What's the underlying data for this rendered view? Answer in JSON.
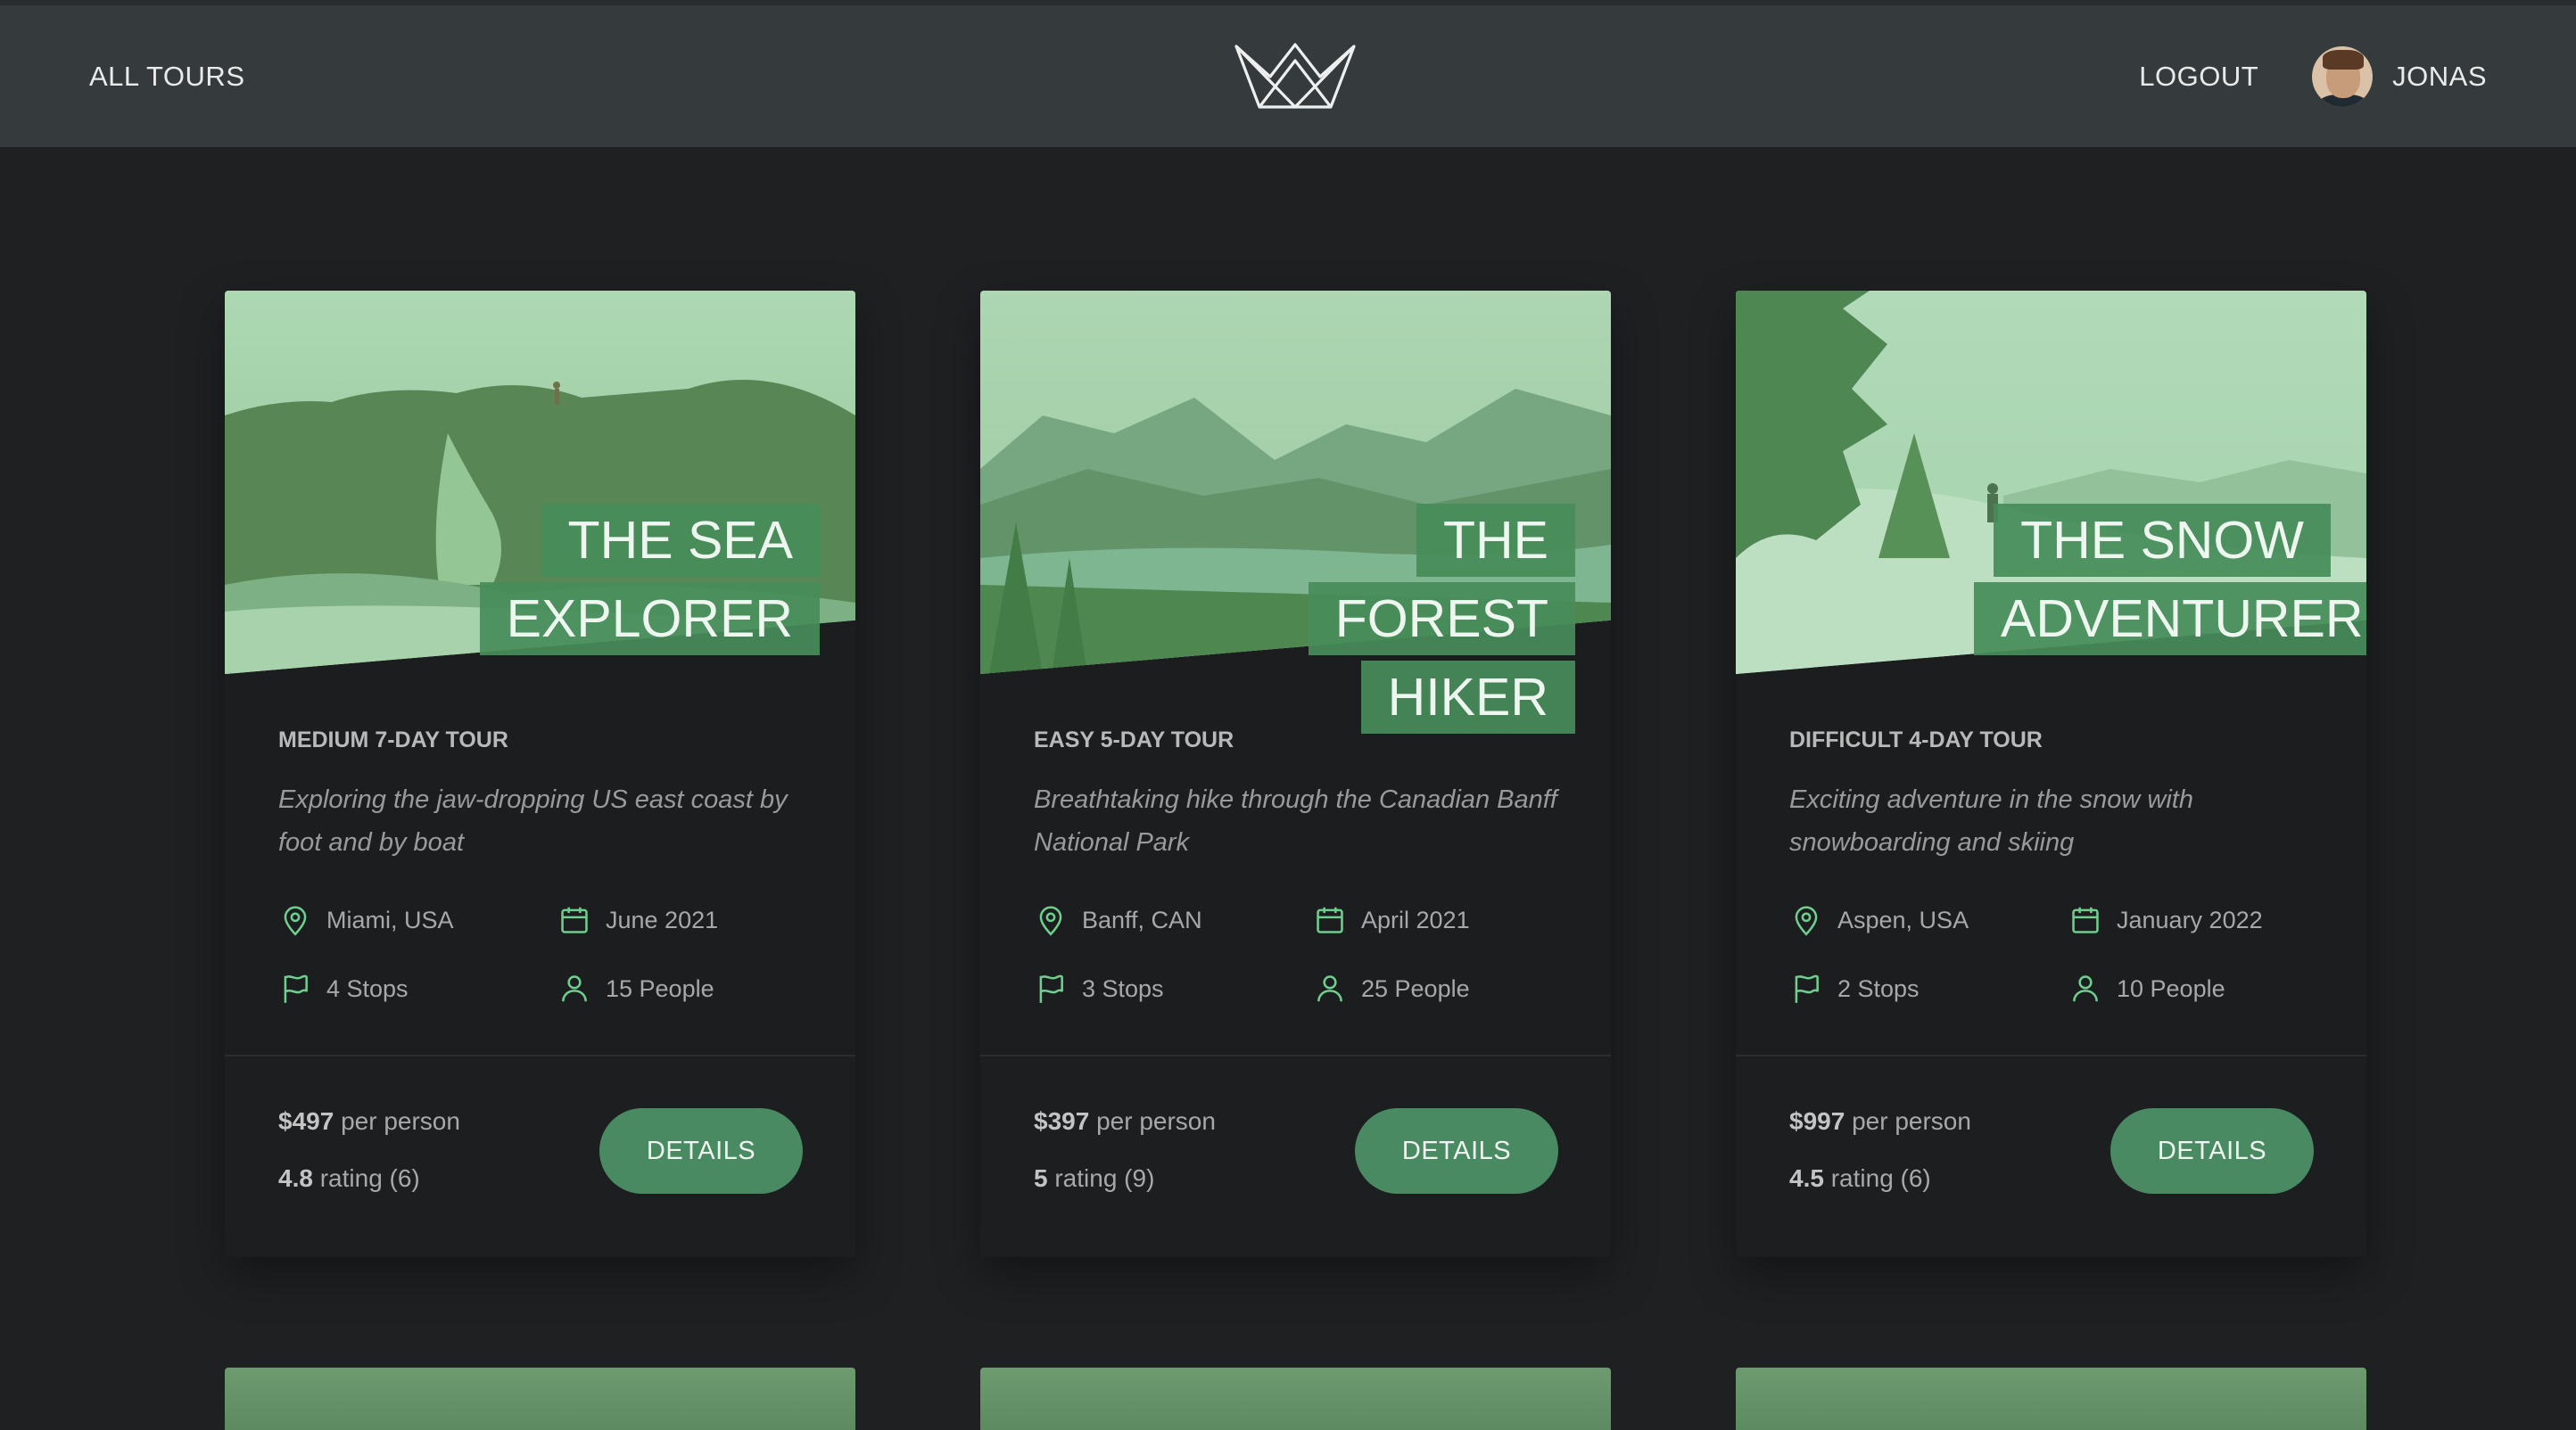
{
  "header": {
    "all_tours": "ALL TOURS",
    "logout": "LOGOUT",
    "user_name": "JONAS"
  },
  "tours": [
    {
      "name_line1": "THE SEA",
      "name_line2": "EXPLORER",
      "difficulty_duration": "MEDIUM 7-DAY TOUR",
      "summary": "Exploring the jaw-dropping US east coast by foot and by boat",
      "location": "Miami, USA",
      "date": "June 2021",
      "stops": "4 Stops",
      "people": "15 People",
      "price": "$497",
      "price_suffix": "per person",
      "rating": "4.8",
      "rating_suffix": "rating (6)",
      "button": "DETAILS"
    },
    {
      "name_line1": "THE FOREST",
      "name_line2": "HIKER",
      "difficulty_duration": "EASY 5-DAY TOUR",
      "summary": "Breathtaking hike through the Canadian Banff National Park",
      "location": "Banff, CAN",
      "date": "April 2021",
      "stops": "3 Stops",
      "people": "25 People",
      "price": "$397",
      "price_suffix": "per person",
      "rating": "5",
      "rating_suffix": "rating (9)",
      "button": "DETAILS"
    },
    {
      "name_line1": "THE SNOW",
      "name_line2": "ADVENTURER",
      "difficulty_duration": "DIFFICULT 4-DAY TOUR",
      "summary": "Exciting adventure in the snow with snowboarding and skiing",
      "location": "Aspen, USA",
      "date": "January 2022",
      "stops": "2 Stops",
      "people": "10 People",
      "price": "$997",
      "price_suffix": "per person",
      "rating": "4.5",
      "rating_suffix": "rating (6)",
      "button": "DETAILS"
    }
  ],
  "icons": {
    "logo": "crown-logo-icon",
    "location": "map-pin-icon",
    "date": "calendar-icon",
    "stops": "flag-icon",
    "people": "user-icon"
  },
  "colors": {
    "accent": "#4a8a63",
    "icon": "#6fcf8f",
    "header_bg": "#353a3d",
    "page_bg": "#1e2022"
  }
}
